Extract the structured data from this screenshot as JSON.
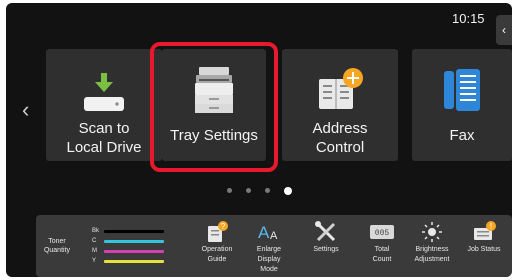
{
  "status": {
    "time": "10:15"
  },
  "side_tab": {
    "icon": "chevron-left-icon",
    "glyph": "‹"
  },
  "carousel": {
    "prev_icon": "chevron-left-icon",
    "prev_glyph": "‹",
    "tiles": [
      {
        "label_line1": "Scan to",
        "label_line2": "Local Drive",
        "icon": "download-scanner-icon"
      },
      {
        "label_line1": "Tray Settings",
        "icon": "printer-icon",
        "selected": true
      },
      {
        "label_line1": "Address",
        "label_line2": "Control",
        "icon": "address-book-icon"
      },
      {
        "label_line1": "Fax",
        "icon": "fax-phone-icon"
      }
    ],
    "page_count": 4,
    "active_page": 4
  },
  "toner": {
    "label_line1": "Toner",
    "label_line2": "Quantity",
    "channels": [
      {
        "name": "Bk",
        "color": "#000000",
        "level": 1.0
      },
      {
        "name": "C",
        "color": "#35c4e0",
        "level": 1.0
      },
      {
        "name": "M",
        "color": "#d53fb3",
        "level": 1.0
      },
      {
        "name": "Y",
        "color": "#e8e03a",
        "level": 1.0
      }
    ]
  },
  "toolbar": {
    "operation_guide": {
      "line1": "Operation",
      "line2": "Guide",
      "icon": "book-help-icon"
    },
    "enlarge_display": {
      "line1": "Enlarge",
      "line2": "Display",
      "line3": "Mode",
      "icon": "text-enlarge-icon"
    },
    "settings": {
      "line1": "Settings",
      "icon": "wrench-screwdriver-icon"
    },
    "total_count": {
      "line1": "Total",
      "line2": "Count",
      "icon": "counter-icon",
      "counter_text": "005"
    },
    "brightness": {
      "line1": "Brightness",
      "line2": "Adjustment",
      "icon": "brightness-icon"
    },
    "job_status": {
      "line1": "Job Status",
      "icon": "job-status-icon",
      "badge": "!"
    }
  },
  "colors": {
    "highlight": "#e8192c",
    "accent_orange": "#f5a623",
    "icon_blue": "#2e86d8",
    "download_green": "#7bc043"
  }
}
